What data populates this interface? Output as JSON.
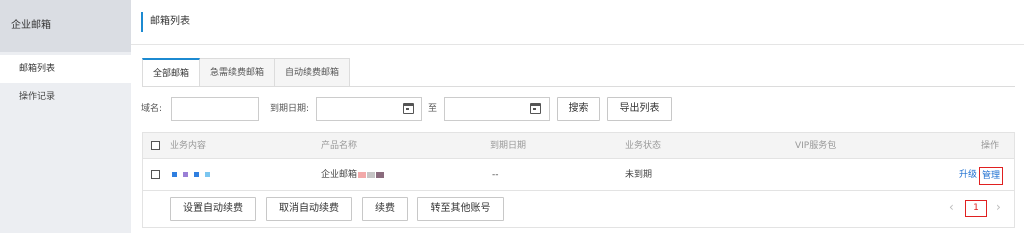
{
  "sidebar": {
    "header": "企业邮箱",
    "items": [
      {
        "label": "邮箱列表"
      },
      {
        "label": "操作记录"
      }
    ]
  },
  "page_title": "邮箱列表",
  "tabs": [
    {
      "label": "全部邮箱"
    },
    {
      "label": "急需续费邮箱"
    },
    {
      "label": "自动续费邮箱"
    }
  ],
  "filter": {
    "domain_label": "域名:",
    "domain_value": "",
    "expiry_label": "到期日期:",
    "date_start": "",
    "to_label": "至",
    "date_end": "",
    "search_label": "搜索",
    "export_label": "导出列表"
  },
  "table": {
    "headers": [
      "业务内容",
      "产品名称",
      "到期日期",
      "业务状态",
      "VIP服务包",
      "操作"
    ],
    "rows": [
      {
        "business": "",
        "product": "企业邮箱",
        "expiry": "--",
        "status": "未到期",
        "vip": "",
        "upgrade": "升级",
        "manage": "管理"
      }
    ]
  },
  "footer": {
    "buttons": [
      "设置自动续费",
      "取消自动续费",
      "续费",
      "转至其他账号"
    ],
    "page": "1",
    "prev_symbol": "‹",
    "next_symbol": "›"
  },
  "colors": {
    "accent": "#1c8ad1",
    "link": "#1c6fd1",
    "highlight": "#e02020",
    "sidebar_bg": "#eceef2"
  }
}
